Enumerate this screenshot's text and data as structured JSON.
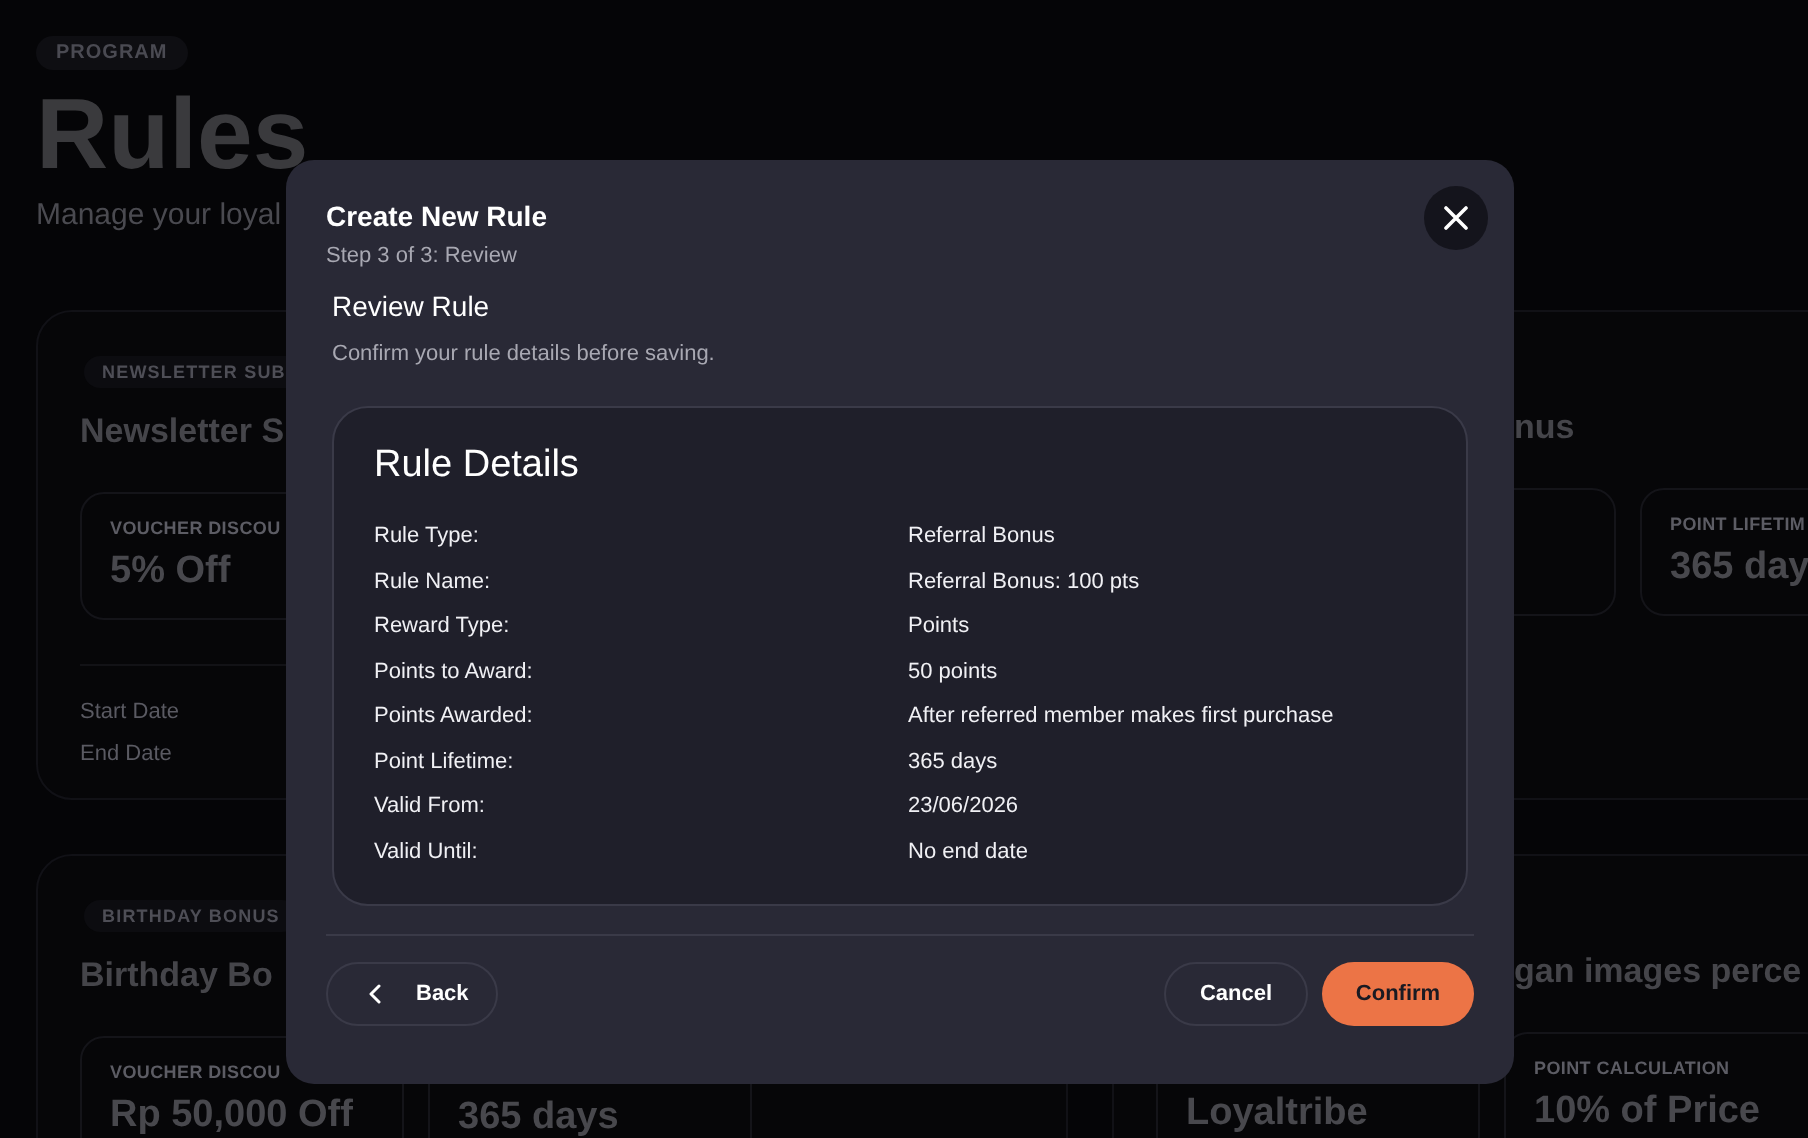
{
  "page": {
    "badge": "PROGRAM",
    "title": "Rules",
    "subtitle": "Manage your loyal"
  },
  "rule_cards": [
    {
      "badge": "NEWSLETTER SUB",
      "title": "Newsletter S",
      "title_clipped_start": false,
      "stats": [
        {
          "label": "VOUCHER DISCOU",
          "value": "5% Off"
        }
      ],
      "dates": [
        "Start Date",
        "End Date"
      ]
    },
    {
      "title": "nus",
      "title_clipped_start": true,
      "hidden_stat_before": true,
      "stats": [
        {
          "label": "POINT LIFETIM",
          "value": "365 day"
        }
      ]
    },
    {
      "badge": "BIRTHDAY BONUS",
      "title": "Birthday Bo",
      "title_clipped_start": false,
      "stats": [
        {
          "label": "VOUCHER DISCOU",
          "value": "Rp 50,000 Off"
        },
        {
          "value": "365 days"
        }
      ]
    },
    {
      "title": "gan images perce",
      "title_clipped_start": true,
      "stats": [
        {
          "value": "Loyaltribe"
        },
        {
          "label": "POINT CALCULATION",
          "value": "10% of Price"
        }
      ]
    }
  ],
  "dialog": {
    "title": "Create New Rule",
    "step": "Step 3 of 3: Review",
    "section_title": "Review Rule",
    "section_description": "Confirm your rule details before saving.",
    "details_title": "Rule Details",
    "details": [
      {
        "label": "Rule Type:",
        "value": "Referral Bonus"
      },
      {
        "label": "Rule Name:",
        "value": "Referral Bonus: 100 pts"
      },
      {
        "label": "Reward Type:",
        "value": "Points"
      },
      {
        "label": "Points to Award:",
        "value": "50 points"
      },
      {
        "label": "Points Awarded:",
        "value": "After referred member makes first purchase"
      },
      {
        "label": "Point Lifetime:",
        "value": "365 days"
      },
      {
        "label": "Valid From:",
        "value": "23/06/2026"
      },
      {
        "label": "Valid Until:",
        "value": "No end date"
      }
    ],
    "buttons": [
      {
        "label": "Back",
        "kind": "back"
      },
      {
        "label": "Cancel",
        "kind": "secondary"
      },
      {
        "label": "Confirm",
        "kind": "primary"
      }
    ]
  }
}
